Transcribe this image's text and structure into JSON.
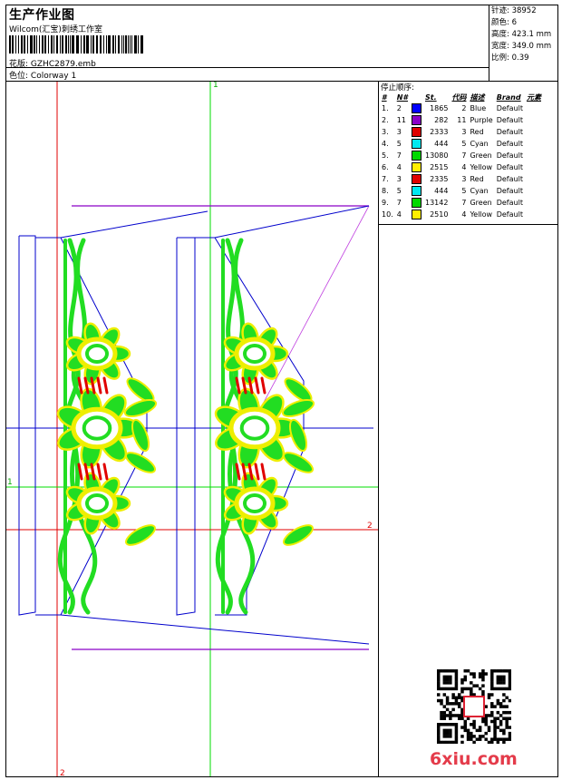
{
  "header": {
    "title": "生产作业图",
    "company": "Wilcom(汇宝)刺绣工作室",
    "design_label": "花版:",
    "design_value": "GZHC2879.emb",
    "colorway_label": "色位:",
    "colorway_value": "Colorway 1"
  },
  "stats": [
    {
      "label": "针迹:",
      "value": "38952"
    },
    {
      "label": "颜色:",
      "value": "6"
    },
    {
      "label": "高度:",
      "value": "423.1 mm"
    },
    {
      "label": "宽度:",
      "value": "349.0 mm"
    },
    {
      "label": "比例:",
      "value": "0.39"
    }
  ],
  "stop_sequence": {
    "title": "停止顺序:",
    "columns": [
      "#",
      "N#",
      "St.",
      "代码",
      "描述",
      "Brand",
      "元素"
    ],
    "rows": [
      {
        "n": "1.",
        "needle": "2",
        "color": "#0000ff",
        "stitches": "1865",
        "code": "2",
        "desc": "Blue",
        "brand": "Default"
      },
      {
        "n": "2.",
        "needle": "11",
        "color": "#8a00c8",
        "stitches": "282",
        "code": "11",
        "desc": "Purple",
        "brand": "Default"
      },
      {
        "n": "3.",
        "needle": "3",
        "color": "#e00000",
        "stitches": "2333",
        "code": "3",
        "desc": "Red",
        "brand": "Default"
      },
      {
        "n": "4.",
        "needle": "5",
        "color": "#00e8f0",
        "stitches": "444",
        "code": "5",
        "desc": "Cyan",
        "brand": "Default"
      },
      {
        "n": "5.",
        "needle": "7",
        "color": "#00d800",
        "stitches": "13080",
        "code": "7",
        "desc": "Green",
        "brand": "Default"
      },
      {
        "n": "6.",
        "needle": "4",
        "color": "#ffee00",
        "stitches": "2515",
        "code": "4",
        "desc": "Yellow",
        "brand": "Default"
      },
      {
        "n": "7.",
        "needle": "3",
        "color": "#e00000",
        "stitches": "2335",
        "code": "3",
        "desc": "Red",
        "brand": "Default"
      },
      {
        "n": "8.",
        "needle": "5",
        "color": "#00e8f0",
        "stitches": "444",
        "code": "5",
        "desc": "Cyan",
        "brand": "Default"
      },
      {
        "n": "9.",
        "needle": "7",
        "color": "#00d800",
        "stitches": "13142",
        "code": "7",
        "desc": "Green",
        "brand": "Default"
      },
      {
        "n": "10.",
        "needle": "4",
        "color": "#ffee00",
        "stitches": "2510",
        "code": "4",
        "desc": "Yellow",
        "brand": "Default"
      }
    ]
  },
  "guides": {
    "v1": "1",
    "v2": "2",
    "h1": "1",
    "h2": "2"
  },
  "watermark": "6xiu.com"
}
